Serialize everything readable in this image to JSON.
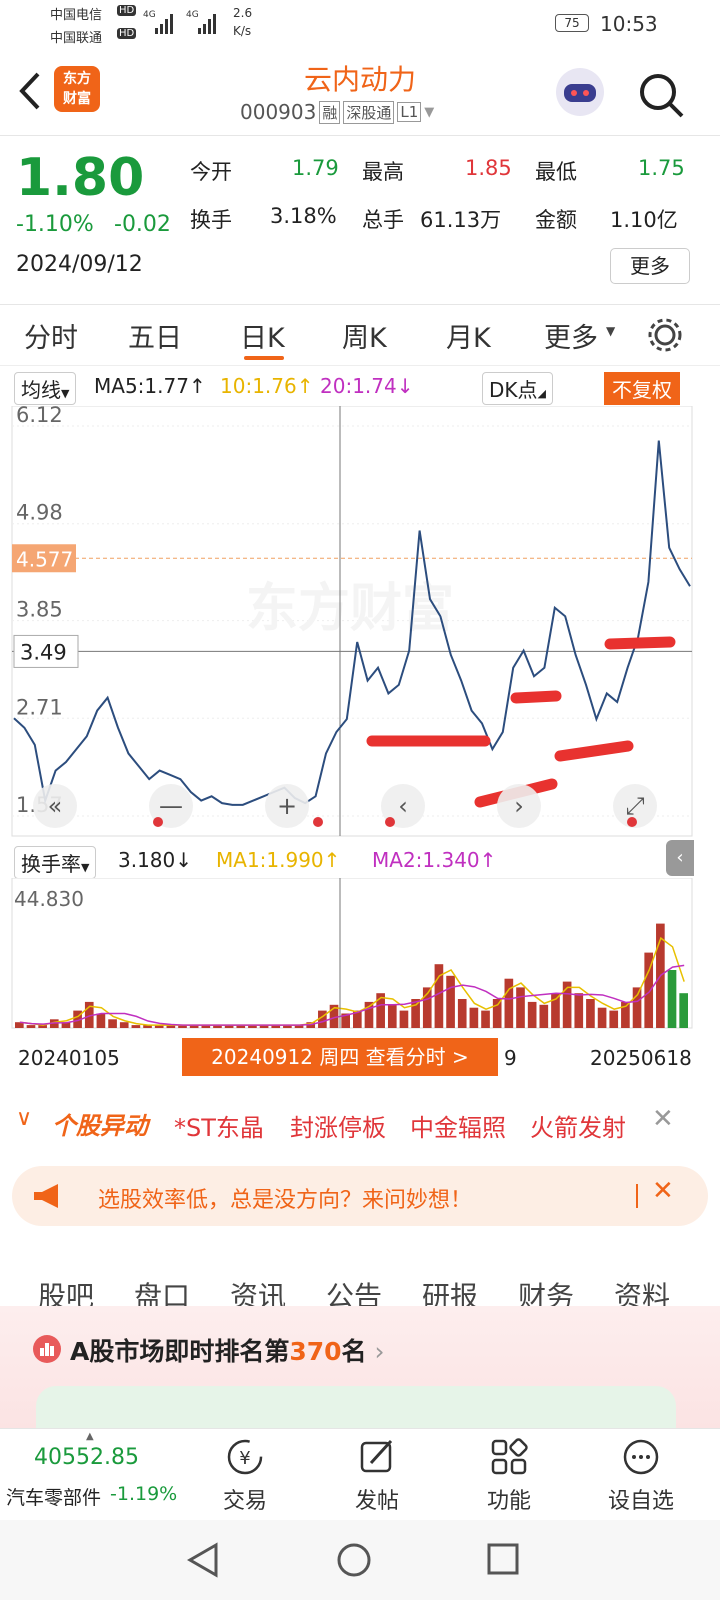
{
  "status": {
    "carrier1": "中国电信",
    "carrier2": "中国联通",
    "hd": "HD",
    "net1": "4G",
    "net2": "4G",
    "speed": "2.6",
    "speed_unit": "K/s",
    "battery": "75",
    "time": "10:53"
  },
  "header": {
    "logo_line1": "东方",
    "logo_line2": "财富",
    "title": "云内动力",
    "code": "000903",
    "badge1": "融",
    "badge2": "深股通",
    "badge3": "L1"
  },
  "quote": {
    "price": "1.80",
    "pct": "-1.10%",
    "chg": "-0.02",
    "date": "2024/09/12",
    "open_label": "今开",
    "open": "1.79",
    "high_label": "最高",
    "high": "1.85",
    "low_label": "最低",
    "low": "1.75",
    "turnover_label": "换手",
    "turnover": "3.18%",
    "volume_label": "总手",
    "volume": "61.13万",
    "amount_label": "金额",
    "amount": "1.10亿",
    "more": "更多"
  },
  "tabs": [
    "分时",
    "五日",
    "日K",
    "周K",
    "月K",
    "更多"
  ],
  "ma": {
    "select": "均线",
    "ma5": "MA5:1.77",
    "ma10": "10:1.76",
    "ma20": "20:1.74",
    "dk": "DK点",
    "fq": "不复权"
  },
  "kchart": {
    "y_labels": [
      "6.12",
      "4.98",
      "3.85",
      "2.71",
      "1.57"
    ],
    "ref_price": "4.577",
    "cursor_price": "3.49",
    "watermark": "东方财富"
  },
  "volchart": {
    "select": "换手率",
    "value": "3.180",
    "ma1": "MA1:1.990",
    "ma2": "MA2:1.340",
    "ymax": "44.830"
  },
  "xaxis": {
    "start": "20240105",
    "end": "20250618",
    "cursor_label": "20240912 周四 查看分时 >",
    "mid_fragment": "9"
  },
  "news": {
    "label": "个股异动",
    "items": [
      "*ST东晶",
      "封涨停板",
      "中金辐照",
      "火箭发射"
    ]
  },
  "ad": {
    "text": "选股效率低，总是没方向？来问妙想！"
  },
  "bottom_tabs": [
    "股吧",
    "盘口",
    "资讯",
    "公告",
    "研报",
    "财务",
    "资料"
  ],
  "rank": {
    "prefix": "A股市场即时排名第",
    "num": "370",
    "suffix": "名"
  },
  "nav": {
    "index_value": "40552.85",
    "index_name": "汽车零部件",
    "index_pct": "-1.19%",
    "trade": "交易",
    "post": "发帖",
    "func": "功能",
    "custom": "设自选"
  },
  "chart_data": [
    {
      "type": "line",
      "title": "",
      "xlabel": "",
      "ylabel": "",
      "x_range": [
        "20240105",
        "20250618"
      ],
      "ylim": [
        1.57,
        6.12
      ],
      "y_ticks": [
        6.12,
        4.98,
        3.85,
        2.71,
        1.57
      ],
      "series": [
        {
          "name": "",
          "values": [
            2.71,
            2.6,
            2.4,
            1.75,
            2.1,
            2.2,
            2.35,
            2.5,
            2.8,
            2.95,
            2.6,
            2.3,
            2.15,
            2.0,
            2.1,
            2.05,
            2.0,
            1.85,
            1.75,
            1.8,
            1.72,
            1.7,
            1.7,
            1.75,
            1.8,
            1.85,
            1.9,
            1.78,
            1.72,
            1.8,
            2.3,
            2.55,
            2.7,
            3.6,
            3.15,
            3.3,
            3.0,
            3.1,
            3.5,
            4.9,
            4.1,
            3.9,
            3.45,
            3.15,
            2.8,
            2.65,
            2.35,
            2.55,
            3.3,
            3.5,
            3.2,
            3.3,
            4.0,
            3.9,
            3.45,
            3.1,
            2.7,
            3.0,
            2.9,
            3.3,
            3.65,
            4.3,
            5.95,
            4.7,
            4.45,
            4.25
          ]
        }
      ]
    },
    {
      "type": "bar",
      "title": "",
      "xlabel": "",
      "ylabel": "",
      "ylim": [
        0,
        44.83
      ],
      "series": [
        {
          "name": "换手率",
          "values": [
            2,
            1,
            1,
            3,
            2,
            6,
            9,
            5,
            3,
            2,
            1,
            1,
            1,
            1,
            1,
            1,
            1,
            1,
            1,
            1,
            1,
            1,
            1,
            1,
            1,
            2,
            6,
            8,
            5,
            6,
            9,
            12,
            8,
            6,
            10,
            14,
            22,
            18,
            10,
            7,
            6,
            10,
            17,
            14,
            9,
            8,
            12,
            16,
            12,
            10,
            7,
            6,
            9,
            14,
            26,
            36,
            20,
            12
          ]
        }
      ]
    }
  ]
}
